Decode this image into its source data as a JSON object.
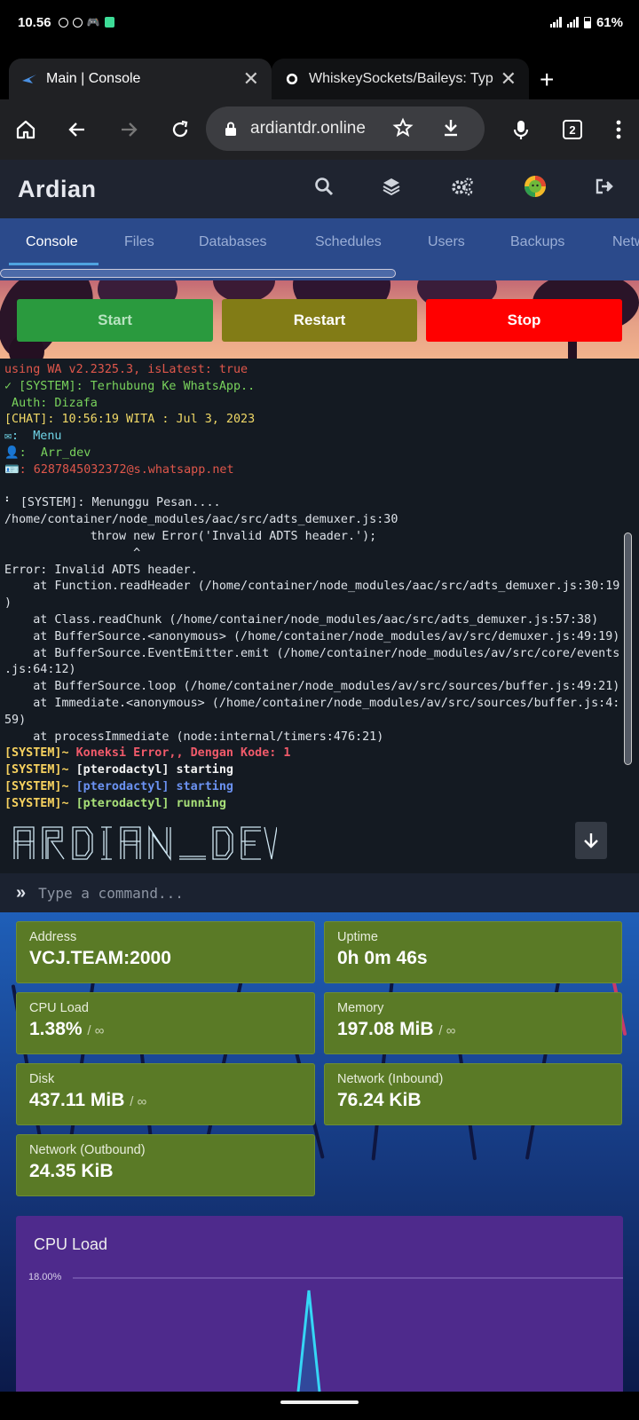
{
  "status_bar": {
    "time": "10.56",
    "battery": "61%"
  },
  "browser": {
    "tabs": [
      {
        "title": "Main | Console"
      },
      {
        "title": "WhiskeySockets/Baileys: Type"
      }
    ],
    "url": "ardiantdr.online",
    "tab_count": "2"
  },
  "panel": {
    "brand": "Ardian",
    "nav": [
      "Console",
      "Files",
      "Databases",
      "Schedules",
      "Users",
      "Backups",
      "Netw"
    ],
    "power": {
      "start": "Start",
      "restart": "Restart",
      "stop": "Stop"
    }
  },
  "console": {
    "lines": [
      {
        "text": "using WA v2.2325.3, isLatest: true",
        "cls": "c-red"
      },
      {
        "text": "✓ [SYSTEM]: Terhubung Ke WhatsApp..",
        "cls": "c-green"
      },
      {
        "text": " Auth: Dizafa",
        "cls": "c-green"
      },
      {
        "text": "[CHAT]: 10:56:19 WITA : Jul 3, 2023",
        "cls": "c-yellow"
      },
      {
        "text": "✉:  Menu",
        "cls": "c-cyan"
      },
      {
        "text": "👤:  Arr_dev",
        "cls": "c-green"
      },
      {
        "text": "🪪: 6287845032372@s.whatsapp.net",
        "cls": "c-red"
      },
      {
        "text": "",
        "cls": ""
      },
      {
        "text": "⠃ [SYSTEM]: Menunggu Pesan....",
        "cls": ""
      },
      {
        "text": "/home/container/node_modules/aac/src/adts_demuxer.js:30",
        "cls": ""
      },
      {
        "text": "            throw new Error('Invalid ADTS header.');",
        "cls": ""
      },
      {
        "text": "                  ^",
        "cls": ""
      },
      {
        "text": "Error: Invalid ADTS header.",
        "cls": ""
      },
      {
        "text": "    at Function.readHeader (/home/container/node_modules/aac/src/adts_demuxer.js:30:19",
        "cls": ""
      },
      {
        "text": ")",
        "cls": ""
      },
      {
        "text": "    at Class.readChunk (/home/container/node_modules/aac/src/adts_demuxer.js:57:38)",
        "cls": ""
      },
      {
        "text": "    at BufferSource.<anonymous> (/home/container/node_modules/av/src/demuxer.js:49:19)",
        "cls": ""
      },
      {
        "text": "    at BufferSource.EventEmitter.emit (/home/container/node_modules/av/src/core/events",
        "cls": ""
      },
      {
        "text": ".js:64:12)",
        "cls": ""
      },
      {
        "text": "    at BufferSource.loop (/home/container/node_modules/av/src/sources/buffer.js:49:21)",
        "cls": ""
      },
      {
        "text": "    at Immediate.<anonymous> (/home/container/node_modules/av/src/sources/buffer.js:4:",
        "cls": ""
      },
      {
        "text": "59)",
        "cls": ""
      },
      {
        "text": "    at processImmediate (node:internal/timers:476:21)",
        "cls": ""
      }
    ],
    "system_lines": [
      {
        "prefix": "[SYSTEM]~ ",
        "text": "Koneksi Error,, Dengan Kode: 1",
        "cls": "c-redb"
      },
      {
        "prefix": "[SYSTEM]~ ",
        "text": "[pterodactyl] starting",
        "cls": "c-white"
      },
      {
        "prefix": "[SYSTEM]~ ",
        "text": "[pterodactyl] starting",
        "cls": "c-blue"
      },
      {
        "prefix": "[SYSTEM]~ ",
        "text": "[pterodactyl] running",
        "cls": "c-lgreen"
      }
    ],
    "ascii_banner": "ARDIAN_DEV",
    "command_placeholder": "Type a command..."
  },
  "stats": {
    "address": {
      "label": "Address",
      "value": "VCJ.TEAM:2000"
    },
    "uptime": {
      "label": "Uptime",
      "value": "0h 0m 46s"
    },
    "cpu": {
      "label": "CPU Load",
      "value": "1.38%",
      "limit": "/ ∞"
    },
    "memory": {
      "label": "Memory",
      "value": "197.08 MiB",
      "limit": "/ ∞"
    },
    "disk": {
      "label": "Disk",
      "value": "437.11 MiB",
      "limit": "/ ∞"
    },
    "net_in": {
      "label": "Network (Inbound)",
      "value": "76.24 KiB"
    },
    "net_out": {
      "label": "Network (Outbound)",
      "value": "24.35 KiB"
    }
  },
  "cpu_chart": {
    "title": "CPU Load",
    "ymax_label": "18.00%"
  },
  "colors": {
    "stat_bg": "#5a7a26",
    "chart_bg": "#4e2a8c",
    "nav_bg": "#2b4a8b",
    "start": "#2a9a3e",
    "restart": "#827c16",
    "stop": "#ff0000"
  }
}
